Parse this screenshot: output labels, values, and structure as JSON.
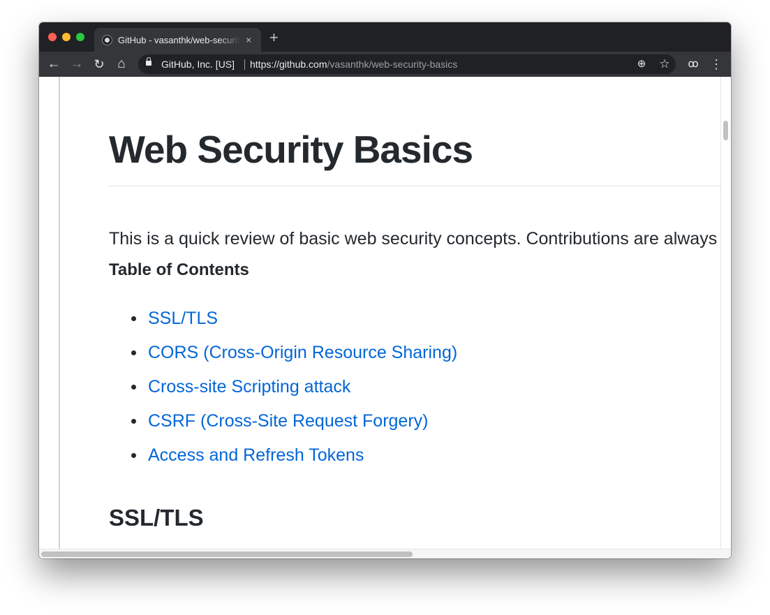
{
  "browser": {
    "tab": {
      "title": "GitHub - vasanthk/web-security-basics",
      "close_glyph": "×",
      "favicon": "github-icon"
    },
    "new_tab_glyph": "+",
    "nav": {
      "back": "←",
      "forward": "→",
      "reload": "↻",
      "home": "⌂"
    },
    "address_bar": {
      "org": "GitHub, Inc. [US]",
      "url_host": "https://github.com",
      "url_path": "/vasanthk/web-security-basics"
    },
    "toolbar_icons": {
      "zoom": "⊕",
      "star": "☆",
      "incognito": "ꚙ",
      "menu": "⋮"
    }
  },
  "readme": {
    "title": "Web Security Basics",
    "intro": "This is a quick review of basic web security concepts. Contributions are always welcome!",
    "toc_heading": "Table of Contents",
    "toc": [
      {
        "label": "SSL/TLS"
      },
      {
        "label": "CORS (Cross-Origin Resource Sharing)"
      },
      {
        "label": "Cross-site Scripting attack"
      },
      {
        "label": "CSRF (Cross-Site Request Forgery)"
      },
      {
        "label": "Access and Refresh Tokens"
      }
    ],
    "section_heading": "SSL/TLS"
  },
  "colors": {
    "titlebar": "#202124",
    "toolbar": "#35363a",
    "link": "#0366d6",
    "text": "#24292e"
  }
}
